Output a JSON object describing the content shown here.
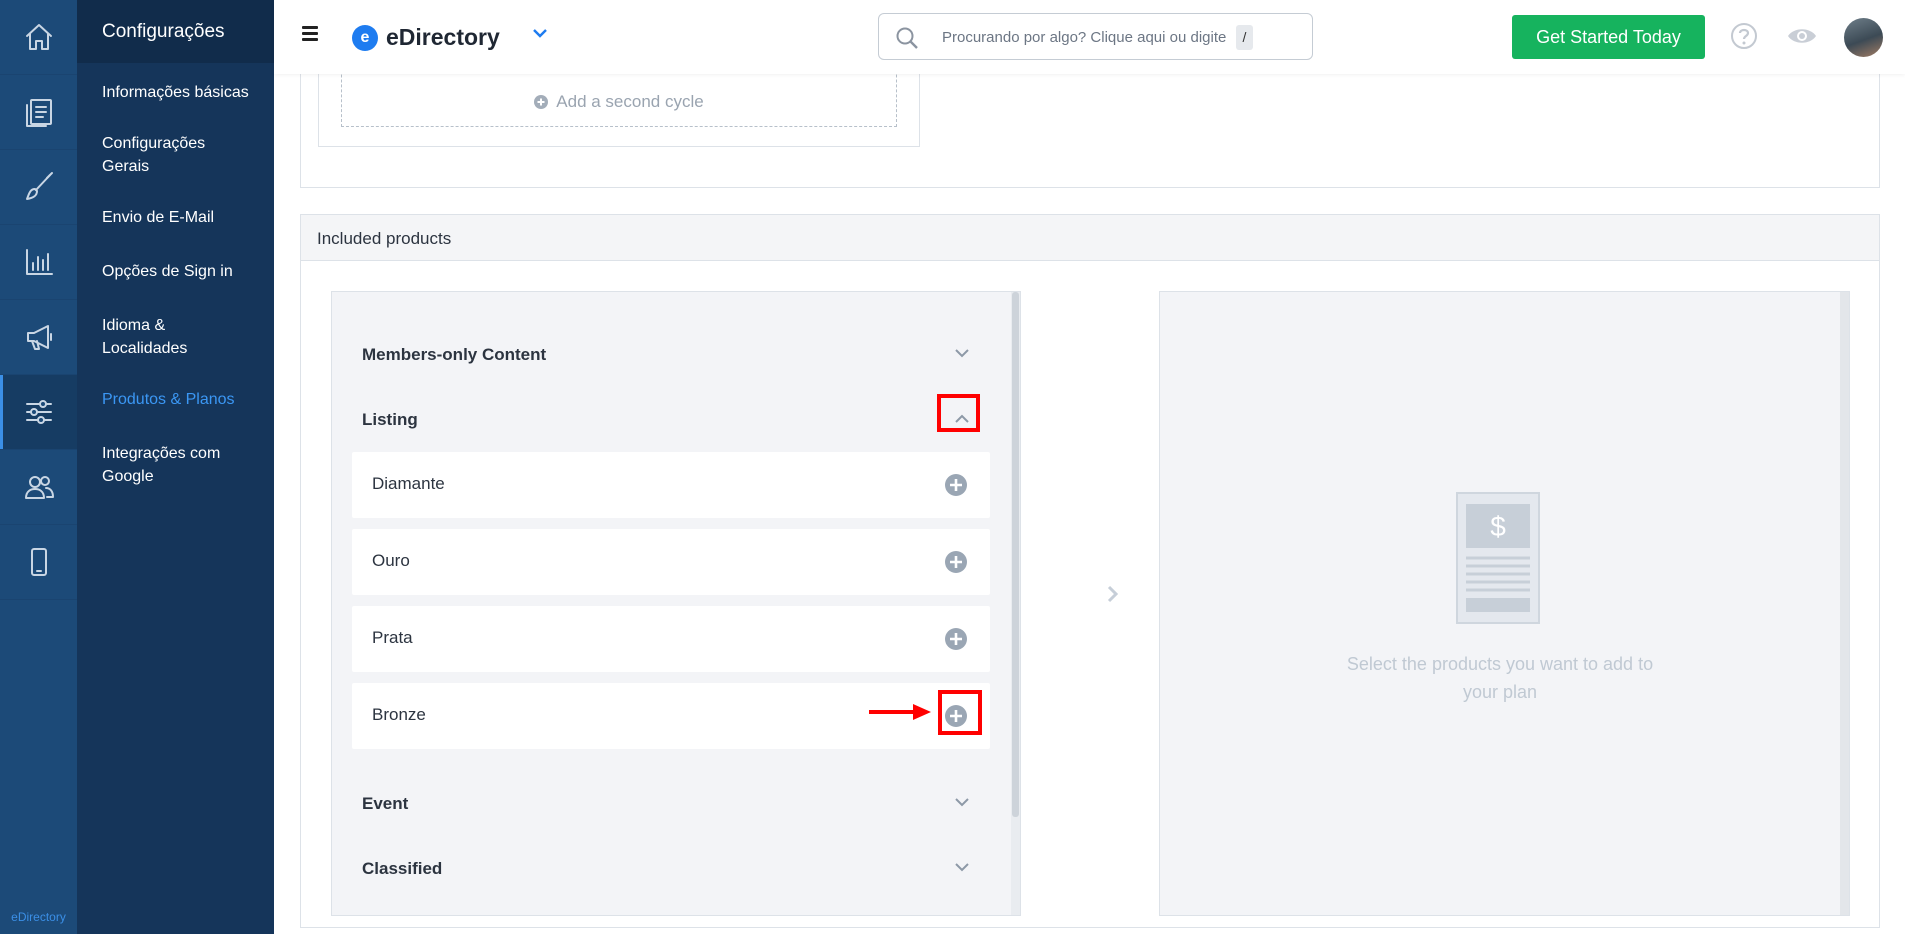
{
  "rail": {
    "items": [
      {
        "icon": "home-icon"
      },
      {
        "icon": "documents-icon"
      },
      {
        "icon": "brush-icon"
      },
      {
        "icon": "bar-chart-icon"
      },
      {
        "icon": "megaphone-icon"
      },
      {
        "icon": "sliders-icon",
        "active": true
      },
      {
        "icon": "users-icon"
      },
      {
        "icon": "mobile-icon"
      }
    ],
    "brand": "eDirectory"
  },
  "subnav": {
    "title": "Configurações",
    "items": [
      {
        "label": "Informações básicas"
      },
      {
        "label": "Configurações Gerais"
      },
      {
        "label": "Envio de E-Mail"
      },
      {
        "label": "Opções de Sign in"
      },
      {
        "label": "Idioma & Localidades"
      },
      {
        "label": "Produtos & Planos",
        "active": true
      },
      {
        "label": "Integrações com Google"
      }
    ]
  },
  "header": {
    "logo_text": "eDirectory",
    "logo_letter": "e",
    "search_placeholder": "Procurando por algo? Clique aqui ou digite",
    "search_shortcut": "/",
    "cta_label": "Get Started Today"
  },
  "cycle": {
    "add_label": "Add a second cycle"
  },
  "products": {
    "title": "Included products",
    "categories": {
      "members": "Members-only Content",
      "listing": "Listing",
      "event": "Event",
      "classified": "Classified"
    },
    "listing_items": [
      "Diamante",
      "Ouro",
      "Prata",
      "Bronze"
    ],
    "empty_text": "Select the products you want to add to your plan"
  },
  "colors": {
    "rail_bg": "#1c4a78",
    "subnav_bg": "#15355a",
    "active_link": "#3b97f4",
    "cta_green": "#16b35e",
    "highlight_red": "#ff0000"
  }
}
